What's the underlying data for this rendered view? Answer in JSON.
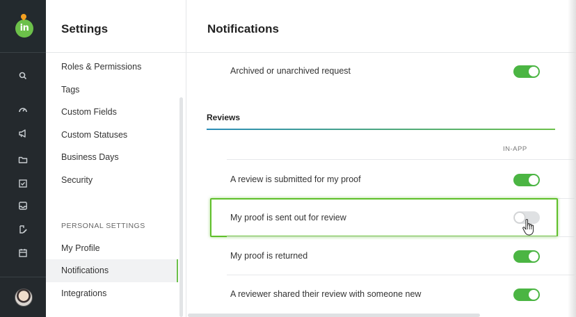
{
  "rail": {
    "logo_text": "in",
    "icons": [
      "search-icon",
      "gauge-icon",
      "megaphone-icon",
      "folder-icon",
      "checkbox-icon",
      "inbox-icon",
      "proof-edit-icon",
      "calendar-icon"
    ]
  },
  "sidebar": {
    "title": "Settings",
    "items": [
      {
        "label": "Roles & Permissions"
      },
      {
        "label": "Tags"
      },
      {
        "label": "Custom Fields"
      },
      {
        "label": "Custom Statuses"
      },
      {
        "label": "Business Days"
      },
      {
        "label": "Security"
      }
    ],
    "personal_section": "PERSONAL SETTINGS",
    "personal_items": [
      {
        "label": "My Profile"
      },
      {
        "label": "Notifications"
      },
      {
        "label": "Integrations"
      }
    ],
    "active_item": "Notifications"
  },
  "main": {
    "title": "Notifications",
    "top_row": {
      "label": "Archived or unarchived request",
      "enabled": true
    },
    "reviews": {
      "section_title": "Reviews",
      "column_header": "IN-APP",
      "rows": [
        {
          "label": "A review is submitted for my proof",
          "enabled": true
        },
        {
          "label": "My proof is sent out for review",
          "enabled": false
        },
        {
          "label": "My proof is returned",
          "enabled": true
        },
        {
          "label": "A reviewer shared their review with someone new",
          "enabled": true
        }
      ]
    }
  },
  "colors": {
    "accent": "#6cc04a",
    "toggle_on": "#4bb543",
    "rail_bg": "#24292d",
    "highlight": "#5fbf2a"
  }
}
